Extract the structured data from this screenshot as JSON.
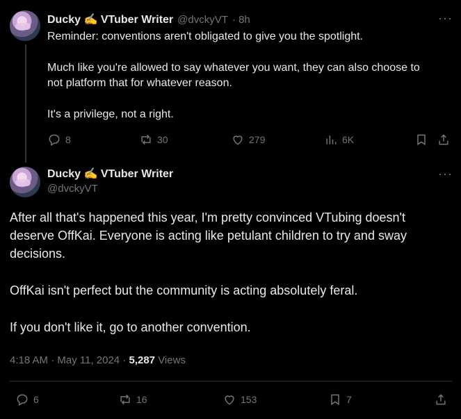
{
  "reply_tweet": {
    "display_name": "Ducky ✍️ VTuber Writer",
    "handle": "@dvckyVT",
    "time": "· 8h",
    "more_label": "···",
    "lines": [
      "Reminder: conventions aren't obligated to give you the spotlight.",
      "Much like you're allowed to say whatever you want, they can also choose to",
      "not platform that for whatever reason.",
      "It's a privilege, not a right."
    ],
    "actions": {
      "replies": "8",
      "reposts": "30",
      "likes": "279",
      "views": "6K"
    }
  },
  "main_tweet": {
    "display_name": "Ducky ✍️ VTuber Writer",
    "handle": "@dvckyVT",
    "more_label": "···",
    "lines": [
      "After all that's happened this year, I'm pretty convinced VTubing doesn't",
      "deserve OffKai. Everyone is acting like petulant children to try and sway",
      "decisions.",
      "OffKai isn't perfect but the community is acting absolutely feral.",
      "If you don't like it, go to another convention."
    ],
    "timestamp": "4:18 AM · May 11, 2024 ·",
    "views_count": "5,287",
    "views_label": "Views",
    "actions": {
      "replies": "6",
      "reposts": "16",
      "likes": "153",
      "bookmarks": "7"
    }
  },
  "colors": {
    "background": "#000000",
    "text": "#e7e9ea",
    "muted": "#71767b",
    "divider": "#2f3336"
  }
}
